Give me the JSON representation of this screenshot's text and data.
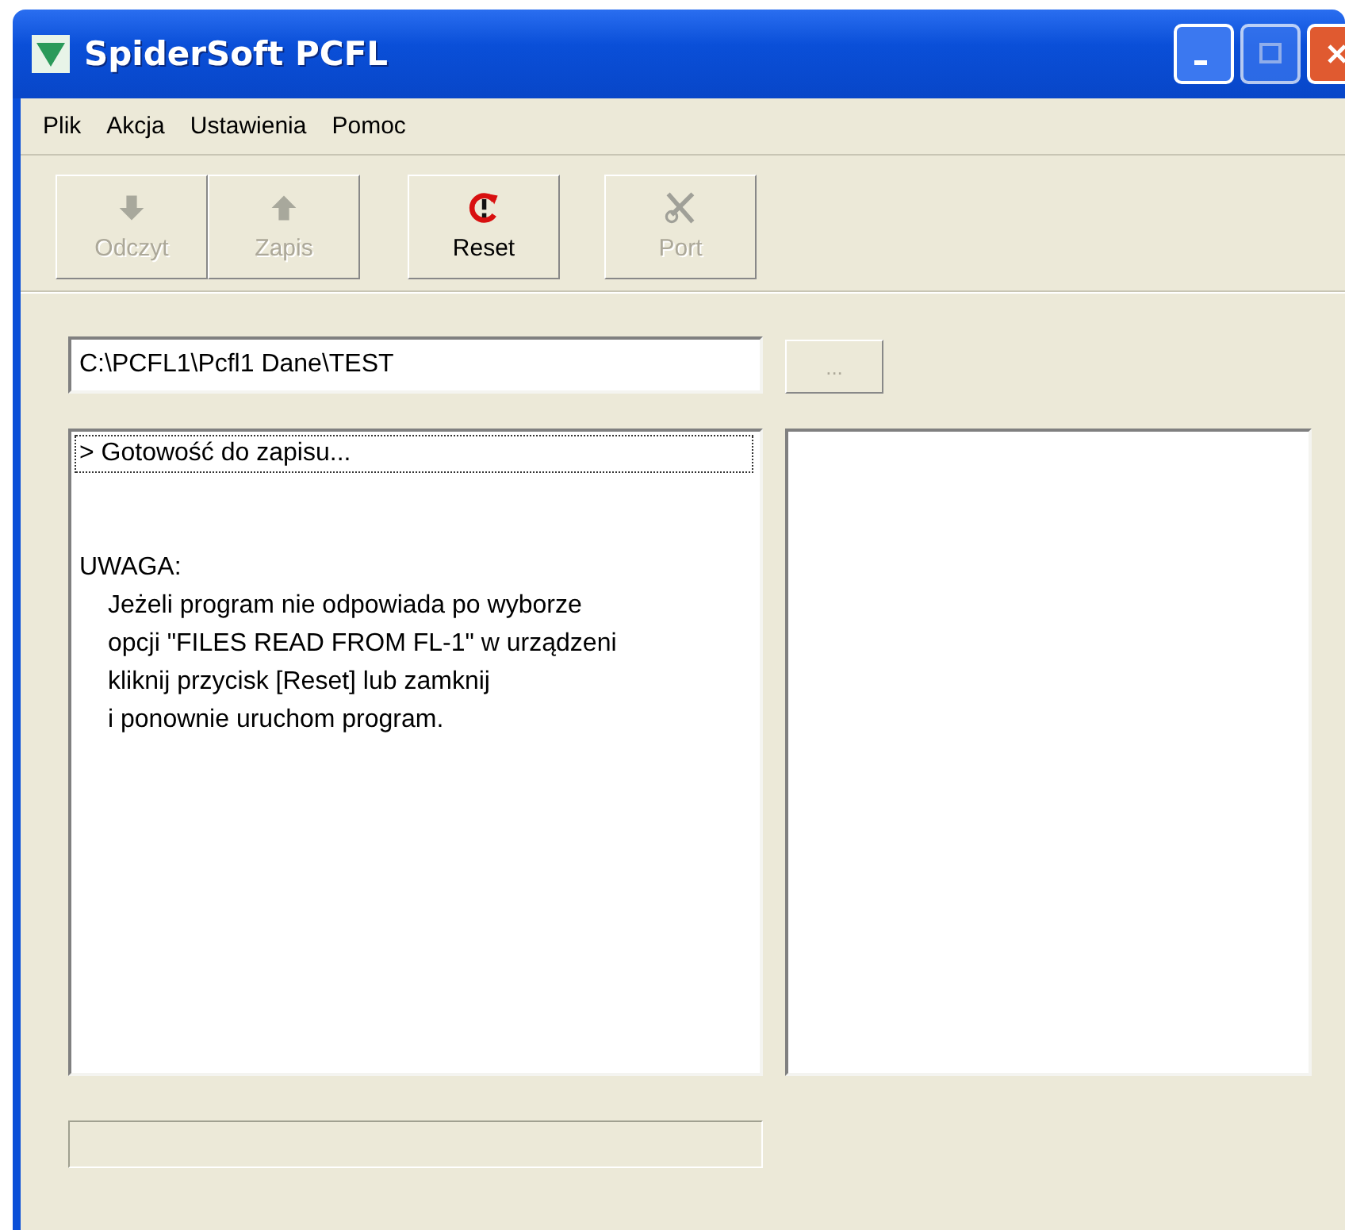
{
  "window": {
    "title": "SpiderSoft PCFL"
  },
  "menu": [
    {
      "label": "Plik"
    },
    {
      "label": "Akcja"
    },
    {
      "label": "Ustawienia"
    },
    {
      "label": "Pomoc"
    }
  ],
  "toolbar": [
    {
      "label": "Odczyt",
      "kind": "download",
      "disabled": true
    },
    {
      "label": "Zapis",
      "kind": "upload",
      "disabled": true
    },
    {
      "label": "Reset",
      "kind": "reset",
      "disabled": false
    },
    {
      "label": "Port",
      "kind": "port",
      "disabled": true
    }
  ],
  "path_field": {
    "value": "C:\\PCFL1\\Pcfl1 Dane\\TEST"
  },
  "browse_button": {
    "label": "...",
    "disabled": true
  },
  "log": [
    {
      "text": "> Gotowość do zapisu...",
      "focused": true,
      "indented": false,
      "gap_before": false
    },
    {
      "text": "UWAGA:",
      "focused": false,
      "indented": false,
      "gap_before": true
    },
    {
      "text": "Jeżeli program nie odpowiada po wyborze",
      "focused": false,
      "indented": true,
      "gap_before": false
    },
    {
      "text": "opcji \"FILES READ FROM FL-1\" w urządzeni",
      "focused": false,
      "indented": true,
      "gap_before": false
    },
    {
      "text": "kliknij przycisk [Reset] lub zamknij",
      "focused": false,
      "indented": true,
      "gap_before": false
    },
    {
      "text": "i ponownie uruchom program.",
      "focused": false,
      "indented": true,
      "gap_before": false
    }
  ],
  "progress": {
    "level": 0
  }
}
